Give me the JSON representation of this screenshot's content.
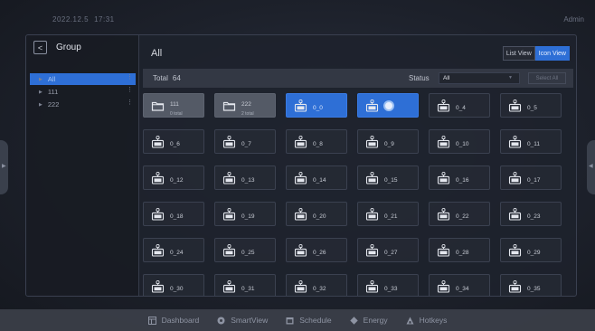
{
  "topbar": {
    "date": "2022.12.5",
    "time": "17:31",
    "user": "Admin"
  },
  "sidebar": {
    "back_glyph": "<",
    "title": "Group",
    "items": [
      {
        "label": "All",
        "active": true
      },
      {
        "label": "111",
        "active": false
      },
      {
        "label": "222",
        "active": false
      }
    ]
  },
  "main": {
    "title": "All",
    "list_view_label": "List View",
    "icon_view_label": "Icon View",
    "total_label": "Total",
    "total_count": "64",
    "status_label": "Status",
    "status_value": "All",
    "select_all_label": "Select All"
  },
  "tiles": [
    {
      "name": "111",
      "sub": "0 total",
      "type": "folder"
    },
    {
      "name": "222",
      "sub": "2 total",
      "type": "folder"
    },
    {
      "name": "0_0",
      "type": "device",
      "selected": true
    },
    {
      "name": "",
      "type": "device",
      "selected": true,
      "loading": true
    },
    {
      "name": "0_4",
      "type": "device"
    },
    {
      "name": "0_5",
      "type": "device"
    },
    {
      "name": "0_6",
      "type": "device"
    },
    {
      "name": "0_7",
      "type": "device"
    },
    {
      "name": "0_8",
      "type": "device"
    },
    {
      "name": "0_9",
      "type": "device"
    },
    {
      "name": "0_10",
      "type": "device"
    },
    {
      "name": "0_11",
      "type": "device"
    },
    {
      "name": "0_12",
      "type": "device"
    },
    {
      "name": "0_13",
      "type": "device"
    },
    {
      "name": "0_14",
      "type": "device"
    },
    {
      "name": "0_15",
      "type": "device"
    },
    {
      "name": "0_16",
      "type": "device"
    },
    {
      "name": "0_17",
      "type": "device"
    },
    {
      "name": "0_18",
      "type": "device"
    },
    {
      "name": "0_19",
      "type": "device"
    },
    {
      "name": "0_20",
      "type": "device"
    },
    {
      "name": "0_21",
      "type": "device"
    },
    {
      "name": "0_22",
      "type": "device"
    },
    {
      "name": "0_23",
      "type": "device"
    },
    {
      "name": "0_24",
      "type": "device"
    },
    {
      "name": "0_25",
      "type": "device"
    },
    {
      "name": "0_26",
      "type": "device"
    },
    {
      "name": "0_27",
      "type": "device"
    },
    {
      "name": "0_28",
      "type": "device"
    },
    {
      "name": "0_29",
      "type": "device"
    },
    {
      "name": "0_30",
      "type": "device"
    },
    {
      "name": "0_31",
      "type": "device"
    },
    {
      "name": "0_32",
      "type": "device"
    },
    {
      "name": "0_33",
      "type": "device"
    },
    {
      "name": "0_34",
      "type": "device"
    },
    {
      "name": "0_35",
      "type": "device"
    }
  ],
  "bottom_nav": [
    {
      "label": "Dashboard",
      "icon": "dashboard-icon"
    },
    {
      "label": "SmartView",
      "icon": "smartview-icon"
    },
    {
      "label": "Schedule",
      "icon": "schedule-icon"
    },
    {
      "label": "Energy",
      "icon": "energy-icon"
    },
    {
      "label": "Hotkeys",
      "icon": "hotkeys-icon"
    }
  ],
  "colors": {
    "accent": "#2e6fd6",
    "panel": "#1e222c",
    "folder_tile": "#545a66"
  }
}
